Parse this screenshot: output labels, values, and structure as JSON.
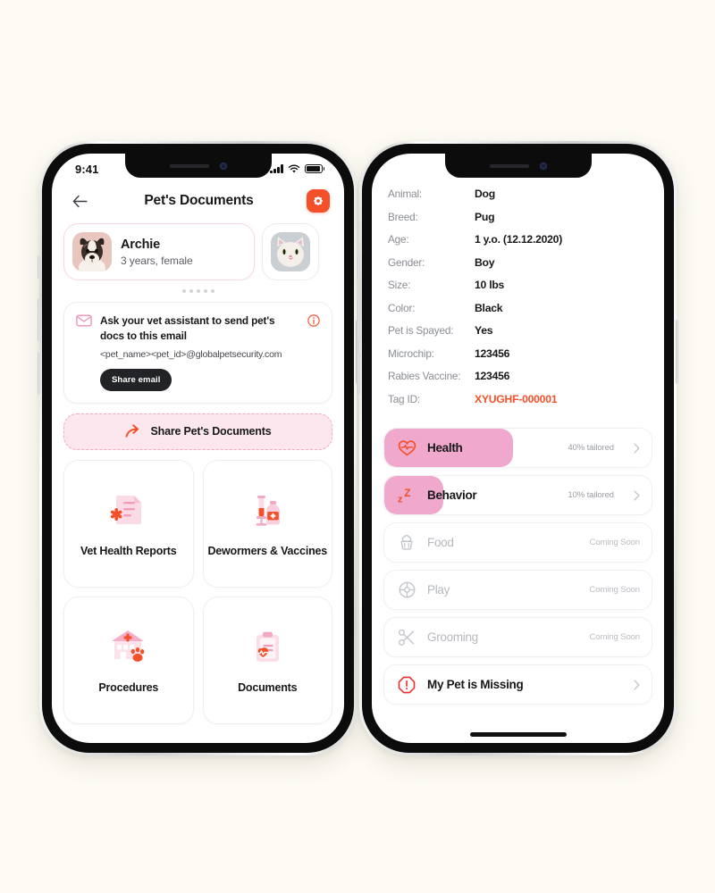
{
  "canvas": {
    "background": "#FDFBF4"
  },
  "theme": {
    "accent": "#F4502A",
    "pink_fill": "#F0A9CC",
    "pink_soft": "#FCE7EE",
    "pink_border": "#F4A8C4",
    "text_dark": "#17181a",
    "text_muted": "#8a8d94",
    "text_disabled": "#b6b9bf"
  },
  "left_phone": {
    "status_bar": {
      "time": "9:41",
      "signal_icon": "cellular-bars-icon",
      "wifi_icon": "wifi-icon",
      "battery_icon": "battery-full-icon"
    },
    "nav": {
      "back_icon": "arrow-left-icon",
      "title": "Pet's Documents",
      "settings_icon": "gear-icon"
    },
    "pets": [
      {
        "name": "Archie",
        "subtitle": "3 years, female",
        "avatar": "dog-photo",
        "selected": true
      },
      {
        "name": "",
        "subtitle": "",
        "avatar": "cat-photo",
        "selected": false
      }
    ],
    "pagination": {
      "count": 5,
      "active_index": 0
    },
    "email_card": {
      "mail_icon": "mail-icon",
      "info_icon": "info-circle-icon",
      "title": "Ask your vet assistant to send pet's docs to this email",
      "address": "<pet_name><pet_id>@globalpetsecurity.com",
      "share_button": "Share email"
    },
    "share_docs_button": {
      "icon": "share-arrow-icon",
      "label": "Share Pet's Documents"
    },
    "tiles": [
      {
        "label": "Vet Health Reports",
        "icon": "medical-report-icon"
      },
      {
        "label": "Dewormers & Vaccines",
        "icon": "syringe-vial-icon"
      },
      {
        "label": "Procedures",
        "icon": "vet-clinic-paw-icon"
      },
      {
        "label": "Documents",
        "icon": "clipboard-heart-icon"
      }
    ]
  },
  "right_phone": {
    "specs": [
      {
        "key": "Animal:",
        "value": "Dog",
        "accent": false
      },
      {
        "key": "Breed:",
        "value": "Pug",
        "accent": false
      },
      {
        "key": "Age:",
        "value": "1 y.o. (12.12.2020)",
        "accent": false
      },
      {
        "key": "Gender:",
        "value": "Boy",
        "accent": false
      },
      {
        "key": "Size:",
        "value": "10 lbs",
        "accent": false
      },
      {
        "key": "Color:",
        "value": "Black",
        "accent": false
      },
      {
        "key": "Pet is Spayed:",
        "value": "Yes",
        "accent": false
      },
      {
        "key": "Microchip:",
        "value": "123456",
        "accent": false
      },
      {
        "key": "Rabies Vaccine:",
        "value": "123456",
        "accent": false
      },
      {
        "key": "Tag ID:",
        "value": "XYUGHF-000001",
        "accent": true
      }
    ],
    "categories": [
      {
        "name": "Health",
        "meta": "40% tailored",
        "icon": "heart-pulse-icon",
        "fill_percent": 40,
        "enabled": true,
        "chevron": true
      },
      {
        "name": "Behavior",
        "meta": "10% tailored",
        "icon": "sleep-zzz-icon",
        "fill_percent": 22,
        "enabled": true,
        "chevron": true
      },
      {
        "name": "Food",
        "meta": "Coming Soon",
        "icon": "cupcake-icon",
        "fill_percent": 0,
        "enabled": false,
        "chevron": false
      },
      {
        "name": "Play",
        "meta": "Coming Soon",
        "icon": "ball-icon",
        "fill_percent": 0,
        "enabled": false,
        "chevron": false
      },
      {
        "name": "Grooming",
        "meta": "Coming Soon",
        "icon": "scissors-icon",
        "fill_percent": 0,
        "enabled": false,
        "chevron": false
      },
      {
        "name": "My Pet is Missing",
        "meta": "",
        "icon": "alert-octagon-icon",
        "fill_percent": 0,
        "enabled": true,
        "chevron": true
      }
    ]
  }
}
